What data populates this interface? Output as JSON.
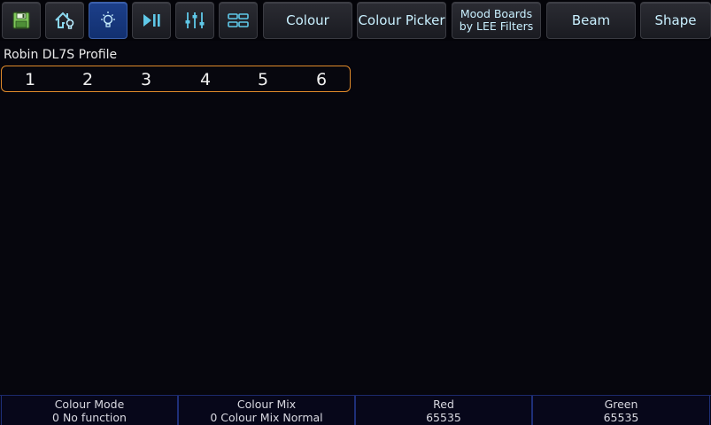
{
  "toolbar": {
    "icons": [
      {
        "name": "save-icon"
      },
      {
        "name": "home-icon"
      },
      {
        "name": "lightbulb-icon"
      },
      {
        "name": "play-pause-icon"
      },
      {
        "name": "faders-icon"
      },
      {
        "name": "grid-icon"
      }
    ],
    "active_icon": "lightbulb-icon",
    "tabs": {
      "colour": "Colour",
      "colour_picker": "Colour Picker",
      "mood_boards_line1": "Mood Boards",
      "mood_boards_line2": "by LEE Filters",
      "beam": "Beam",
      "shape": "Shape"
    },
    "accent": "#c9f0ff",
    "active_color": "#1c3f8a"
  },
  "fixture": {
    "title": "Robin DL7S Profile",
    "cells": [
      "1",
      "2",
      "3",
      "4",
      "5",
      "6"
    ],
    "selector_border_color": "#e08a2a"
  },
  "encoders": [
    {
      "label": "Colour Mode",
      "value": "0 No function"
    },
    {
      "label": "Colour Mix",
      "value": "0 Colour Mix Normal"
    },
    {
      "label": "Red",
      "value": "65535"
    },
    {
      "label": "Green",
      "value": "65535"
    }
  ]
}
